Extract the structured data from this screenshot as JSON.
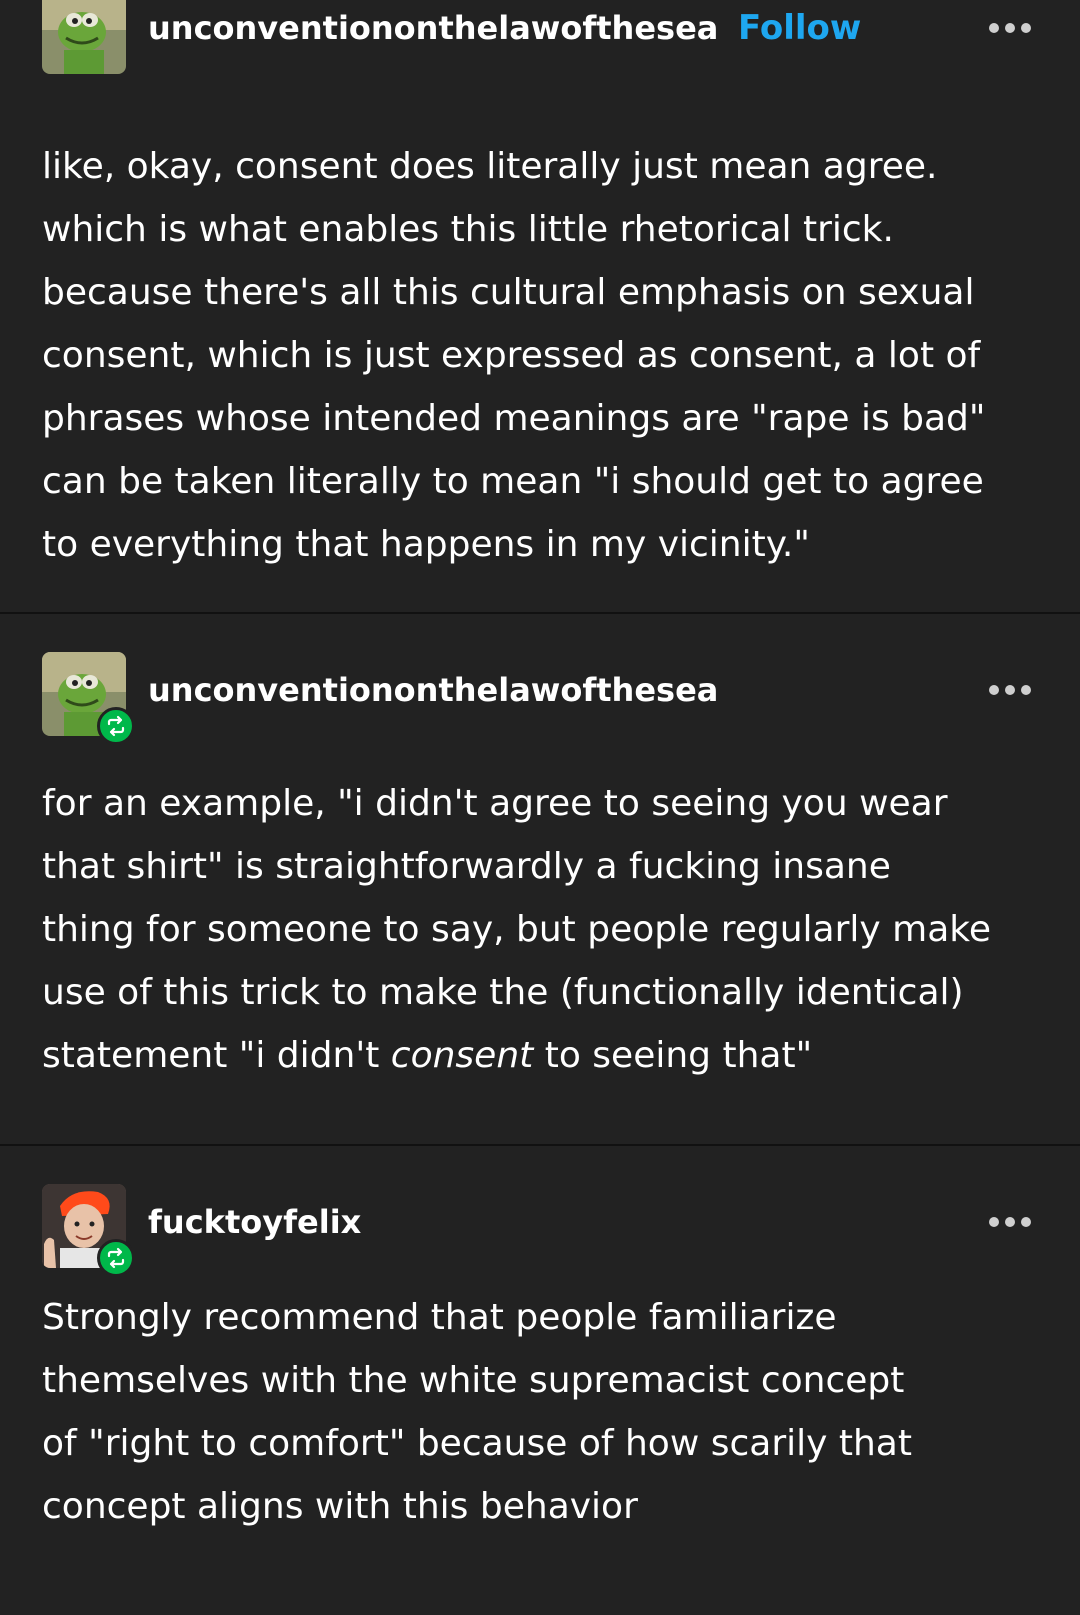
{
  "posts": [
    {
      "username": "unconventiononthelawofthesea",
      "follow_label": "Follow",
      "avatar_icon": "kermit-avatar",
      "reblog": false,
      "body_lines": [
        "like, okay, consent does literally just mean agree.",
        "which is what enables this little rhetorical trick.",
        "because there's all this cultural emphasis on sexual",
        "consent, which is just expressed as consent, a lot of",
        "phrases whose intended meanings are \"rape is bad\"",
        "can be taken literally to mean \"i should get to agree",
        "to everything that happens in my vicinity.\""
      ]
    },
    {
      "username": "unconventiononthelawofthesea",
      "avatar_icon": "kermit-avatar",
      "reblog": true,
      "body_lines": [
        "for an example, \"i didn't agree to seeing you wear",
        "that shirt\" is straightforwardly a fucking insane",
        "thing for someone to say, but people regularly make",
        "use of this trick to make the (functionally identical)"
      ],
      "last_line_pre": "statement \"i didn't ",
      "last_line_em": "consent",
      "last_line_post": " to seeing that\""
    },
    {
      "username": "fucktoyfelix",
      "avatar_icon": "person-avatar",
      "reblog": true,
      "body_lines": [
        "Strongly recommend that people familiarize",
        "themselves with the white supremacist concept",
        "of \"right to comfort\" because of how scarily that",
        "concept aligns with this behavior"
      ]
    }
  ],
  "colors": {
    "background": "#222222",
    "follow": "#1ea7f0",
    "reblog_badge": "#00b84a"
  },
  "icons": [
    "more-options-icon",
    "reblog-icon"
  ]
}
